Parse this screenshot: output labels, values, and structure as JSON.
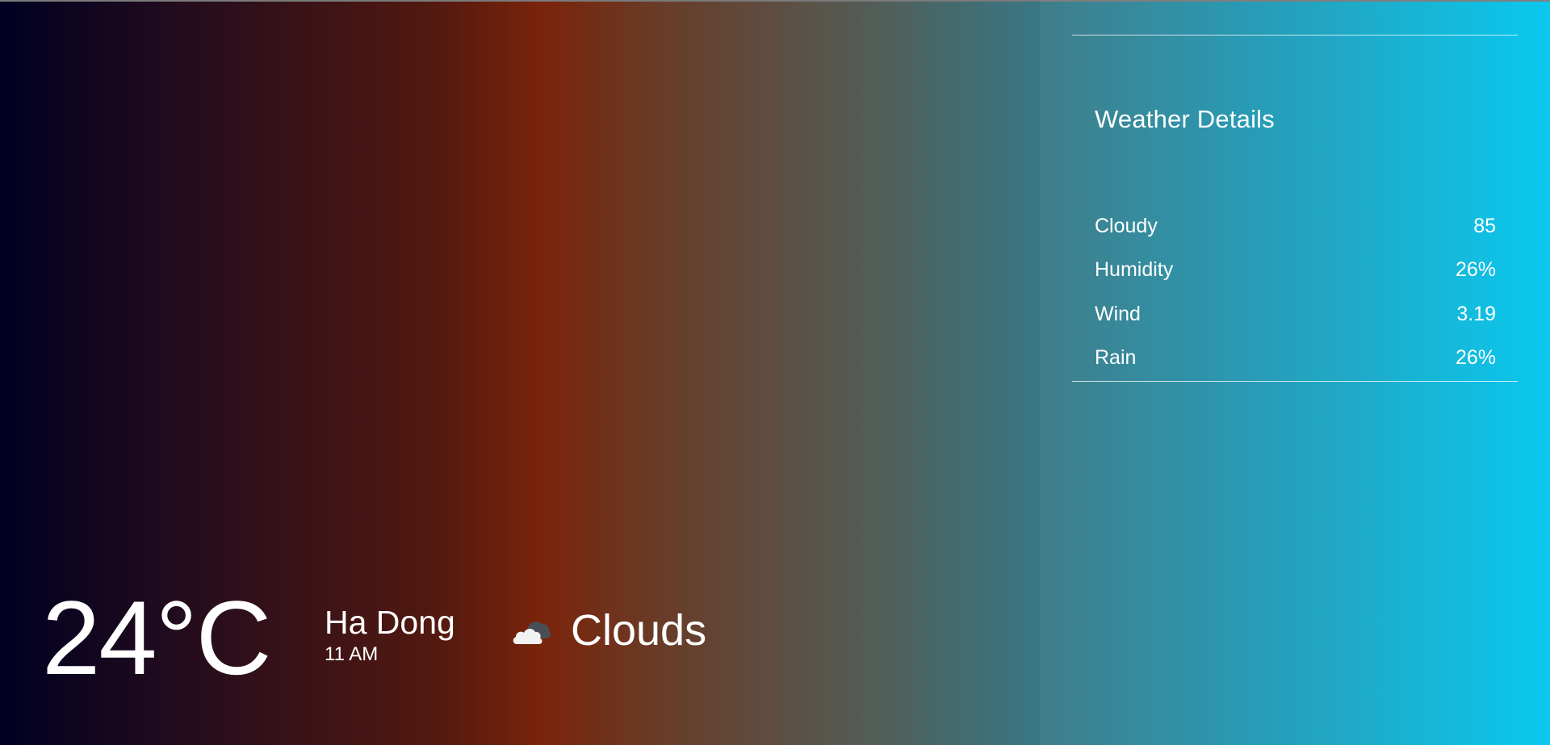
{
  "current": {
    "temperature": "24°C",
    "city": "Ha Dong",
    "time": "11 AM",
    "condition": "Clouds",
    "condition_icon": "cloud-icon"
  },
  "details": {
    "title": "Weather Details",
    "items": [
      {
        "label": "Cloudy",
        "value": "85"
      },
      {
        "label": "Humidity",
        "value": "26%"
      },
      {
        "label": "Wind",
        "value": "3.19"
      },
      {
        "label": "Rain",
        "value": "26%"
      }
    ]
  },
  "colors": {
    "gradient_start": "#000022",
    "gradient_mid": "#7a240a",
    "gradient_end": "#00c6ee",
    "text": "#ffffff"
  }
}
